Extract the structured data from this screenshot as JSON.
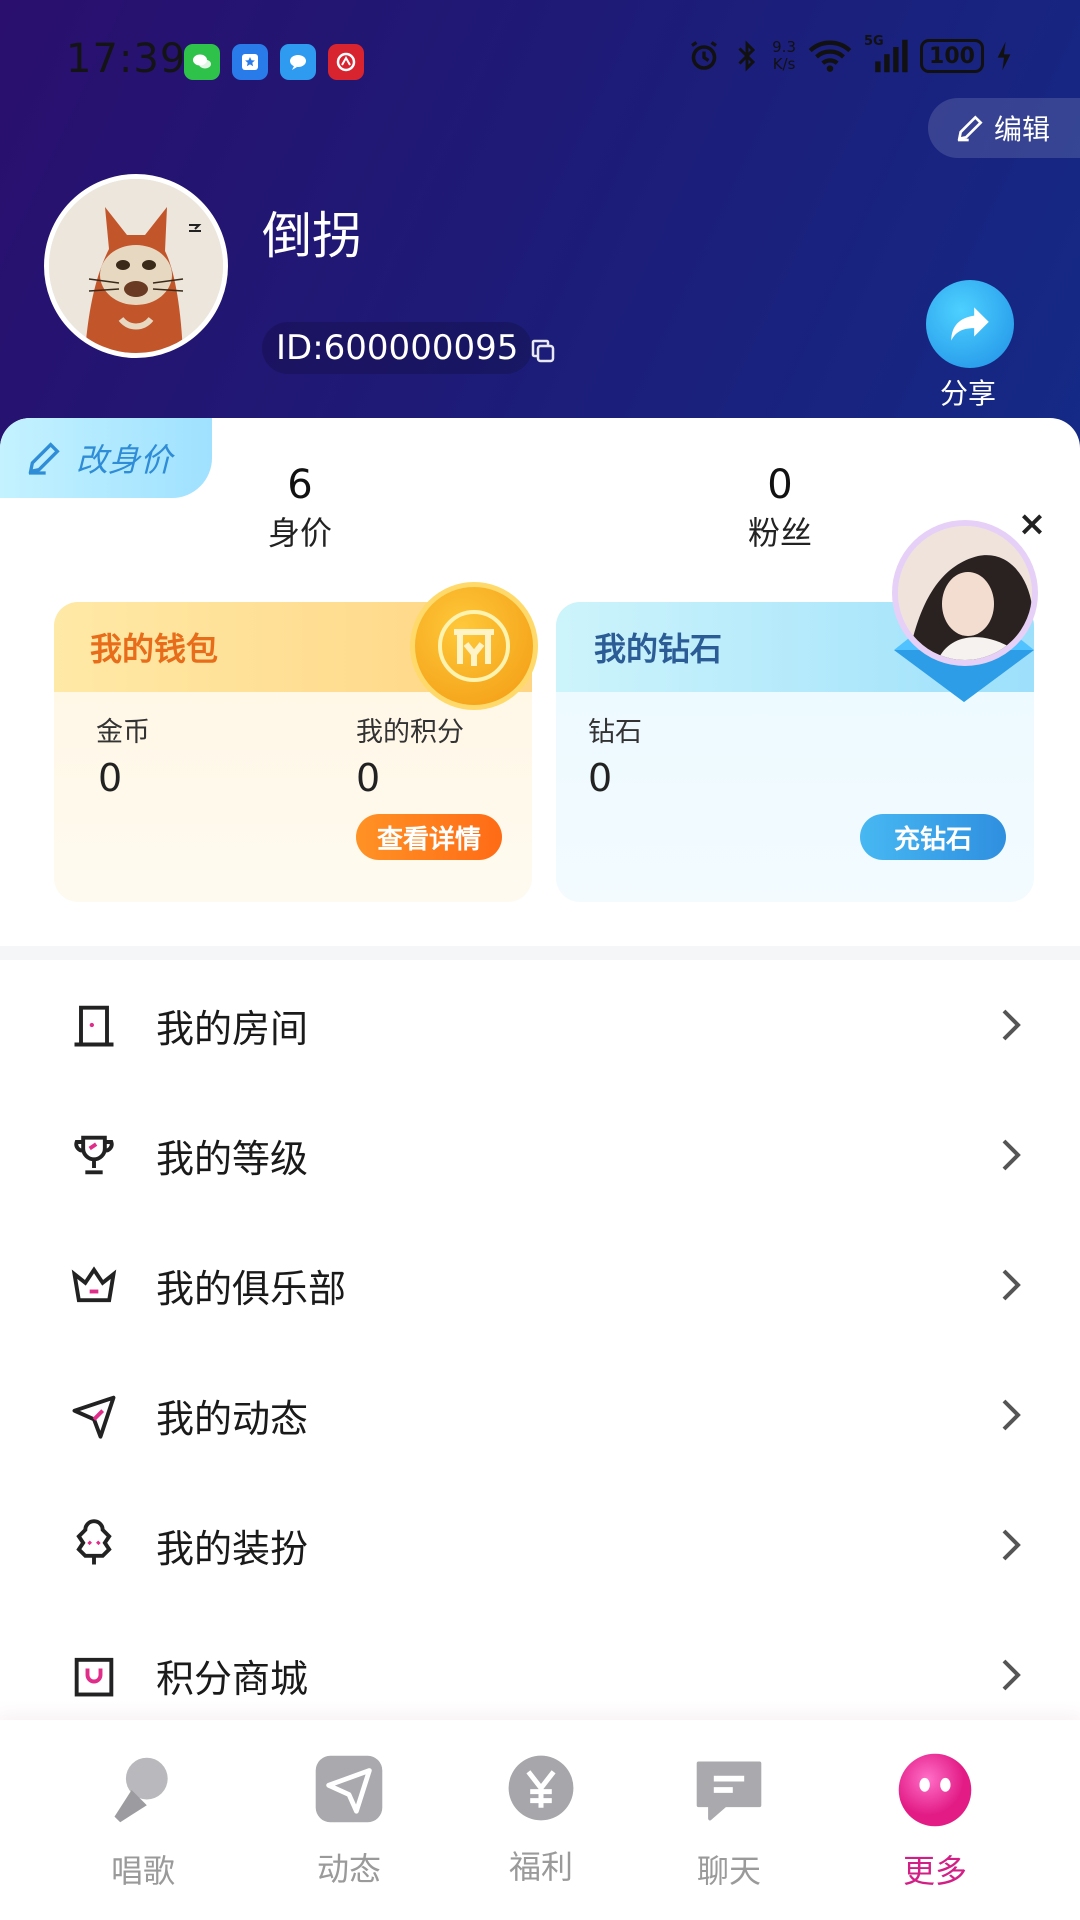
{
  "status_bar": {
    "time": "17:39",
    "net_speed_top": "9.3",
    "net_speed_bottom": "K/s",
    "network": "5G",
    "battery": "100"
  },
  "header": {
    "edit_label": "编辑",
    "username": "倒拐",
    "user_id": "ID:600000095",
    "share_label": "分享"
  },
  "price_button": {
    "label": "改身价"
  },
  "stats": [
    {
      "value": "6",
      "label": "身价"
    },
    {
      "value": "0",
      "label": "粉丝"
    }
  ],
  "wallet": {
    "title": "我的钱包",
    "coins_label": "金币",
    "coins_value": "0",
    "points_label": "我的积分",
    "points_value": "0",
    "detail_button": "查看详情"
  },
  "diamond": {
    "title": "我的钻石",
    "diamond_label": "钻石",
    "diamond_value": "0",
    "recharge_button": "充钻石"
  },
  "menu": [
    {
      "label": "我的房间",
      "icon": "door-icon"
    },
    {
      "label": "我的等级",
      "icon": "trophy-icon"
    },
    {
      "label": "我的俱乐部",
      "icon": "crown-icon"
    },
    {
      "label": "我的动态",
      "icon": "paper-plane-icon"
    },
    {
      "label": "我的装扮",
      "icon": "dress-up-icon"
    },
    {
      "label": "积分商城",
      "icon": "shopping-bag-icon"
    }
  ],
  "tabs": [
    {
      "label": "唱歌",
      "icon": "microphone-icon",
      "active": false
    },
    {
      "label": "动态",
      "icon": "paper-plane-icon",
      "active": false
    },
    {
      "label": "福利",
      "icon": "yen-coin-icon",
      "active": false
    },
    {
      "label": "聊天",
      "icon": "chat-bubble-icon",
      "active": false
    },
    {
      "label": "更多",
      "icon": "smiley-face-icon",
      "active": true
    }
  ],
  "colors": {
    "header_start": "#2a0f6e",
    "header_end": "#142a86",
    "accent_orange": "#ff7a1c",
    "accent_blue": "#2f8fe0",
    "active_tab": "#d21f86"
  }
}
